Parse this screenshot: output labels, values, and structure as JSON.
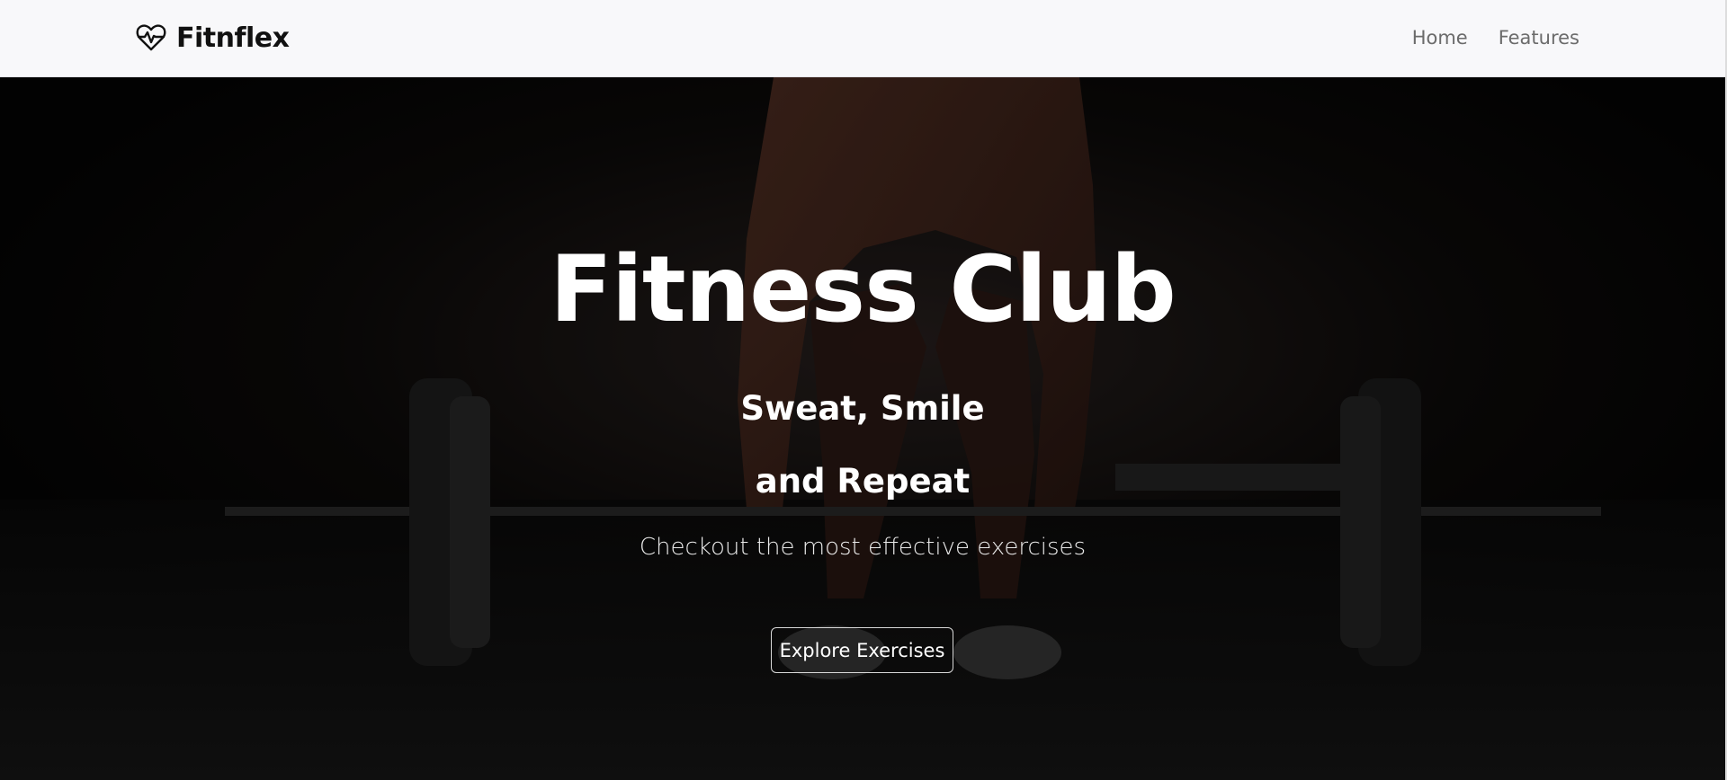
{
  "navbar": {
    "brand_name": "Fitnflex",
    "brand_icon": "heartbeat-icon",
    "links": [
      {
        "label": "Home"
      },
      {
        "label": "Features"
      }
    ]
  },
  "hero": {
    "title": "Fitness Club",
    "subtitle_line1": "Sweat, Smile",
    "subtitle_line2": "and Repeat",
    "description": "Checkout the most effective exercises",
    "cta_label": "Explore Exercises"
  },
  "colors": {
    "navbar_bg": "#f8f8fa",
    "hero_bg": "#050505",
    "text_primary": "#ffffff",
    "nav_link": "#6b6b6b",
    "brand": "#111111"
  }
}
